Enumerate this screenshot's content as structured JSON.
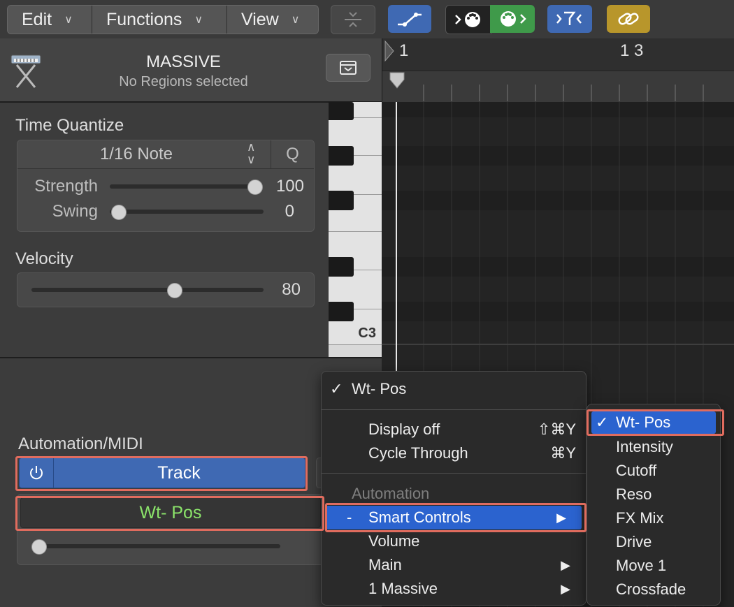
{
  "menubar": {
    "edit": "Edit",
    "functions": "Functions",
    "view": "View"
  },
  "toolbar_icons": [
    "collapse-icon",
    "automation-curve-icon",
    "midi-in-icon",
    "midi-out-icon",
    "filter-icon",
    "link-icon"
  ],
  "header": {
    "title": "MASSIVE",
    "subtitle": "No Regions selected"
  },
  "time_quantize": {
    "label": "Time Quantize",
    "value": "1/16 Note",
    "q_label": "Q",
    "strength_label": "Strength",
    "strength_value": "100",
    "strength_level": 1.0,
    "swing_label": "Swing",
    "swing_value": "0",
    "swing_level": 0.0
  },
  "velocity": {
    "label": "Velocity",
    "value": "80",
    "level": 0.6
  },
  "automation": {
    "label": "Automation/MIDI",
    "mode": "Track",
    "parameter": "Wt- Pos"
  },
  "piano": {
    "c3_label": "C3"
  },
  "ruler": {
    "bar1": "1",
    "bar13": "1 3"
  },
  "main_menu": {
    "current": "Wt- Pos",
    "display_off": "Display off",
    "display_off_shortcut": "⇧⌘Y",
    "cycle_through": "Cycle Through",
    "cycle_through_shortcut": "⌘Y",
    "section_automation": "Automation",
    "smart_controls_prefix": "-",
    "smart_controls": "Smart Controls",
    "volume": "Volume",
    "main": "Main",
    "massive": "1 Massive"
  },
  "submenu": {
    "items": [
      "Wt- Pos",
      "Intensity",
      "Cutoff",
      "Reso",
      "FX Mix",
      "Drive",
      "Move 1",
      "Crossfade"
    ]
  },
  "colors": {
    "accent_blue": "#2b63cf",
    "track_blue": "#3f69b3",
    "param_green": "#8be36a",
    "highlight_red": "#e06c5e",
    "link_gold": "#b8962b"
  }
}
